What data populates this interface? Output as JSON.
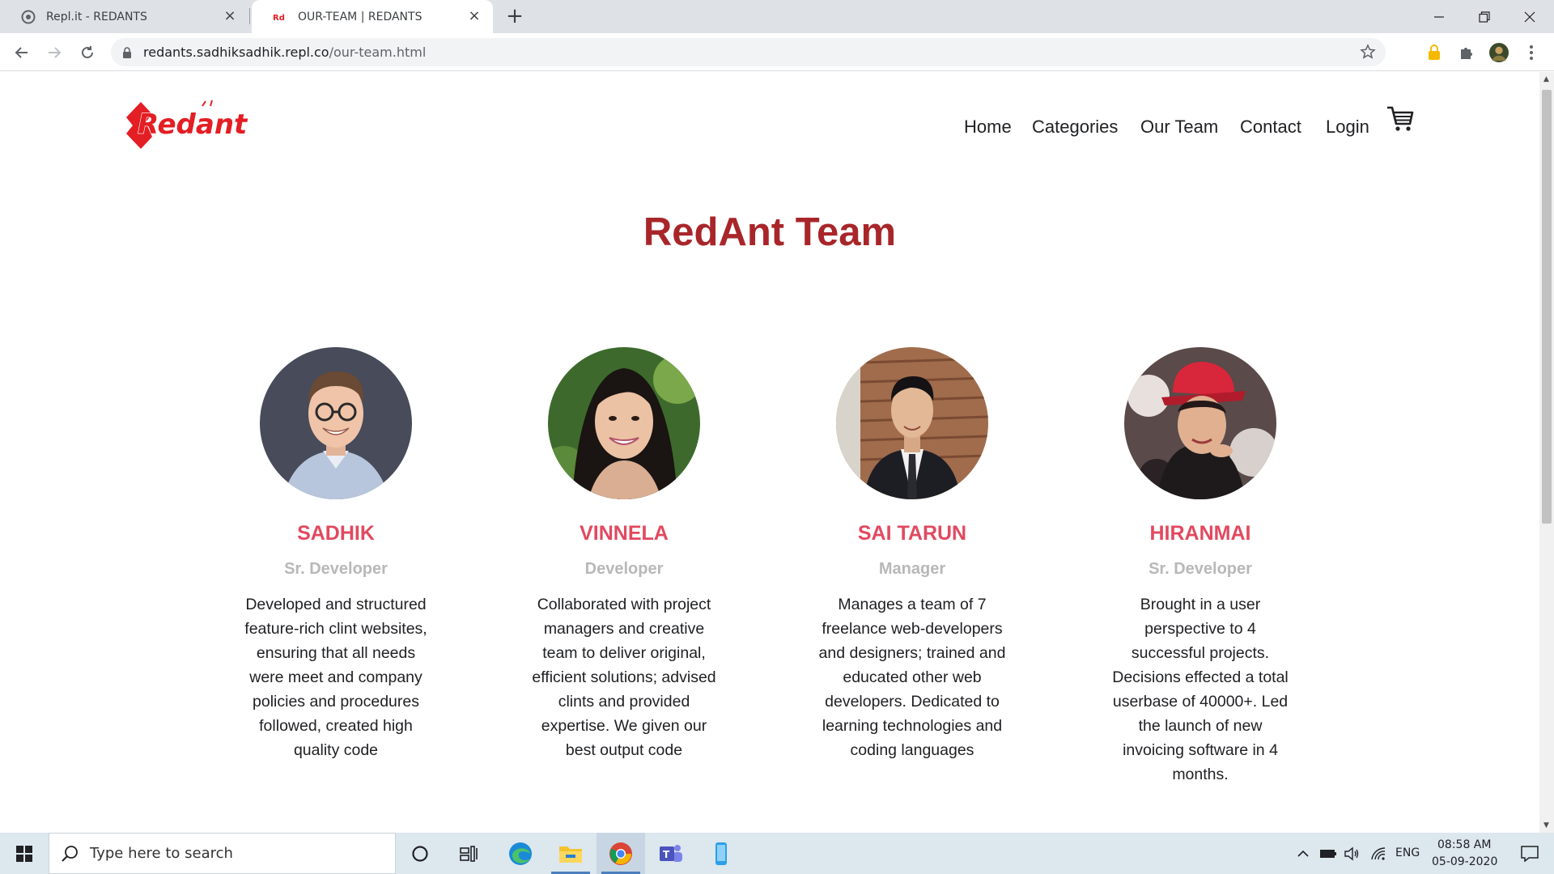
{
  "browser": {
    "tabs": [
      {
        "title": "Repl.it - REDANTS",
        "active": false
      },
      {
        "title": "OUR-TEAM | REDANTS",
        "active": true
      }
    ],
    "url_host": "redants.sadhiksadhik.repl.co",
    "url_path": "/our-team.html"
  },
  "nav": {
    "items": [
      "Home",
      "Categories",
      "Our Team",
      "Contact",
      "Login"
    ]
  },
  "logo_text": "Redant",
  "page": {
    "title": "RedAnt Team"
  },
  "team": [
    {
      "name": "SADHIK",
      "role": "Sr. Developer",
      "description": "Developed and structured feature-rich clint websites, ensuring that all needs were meet and company policies and procedures followed, created high quality code"
    },
    {
      "name": "VINNELA",
      "role": "Developer",
      "description": "Collaborated with project managers and creative team to deliver original, efficient solutions; advised clints and provided expertise. We given our best output code"
    },
    {
      "name": "SAI TARUN",
      "role": "Manager",
      "description": "Manages a team of 7 freelance web-developers and designers; trained and educated other web developers. Dedicated to learning technologies and coding languages"
    },
    {
      "name": "HIRANMAI",
      "role": "Sr. Developer",
      "description": "Brought in a user perspective to 4 successful projects. Decisions effected a total userbase of 40000+. Led the launch of new invoicing software in 4 months."
    }
  ],
  "taskbar": {
    "search_placeholder": "Type here to search",
    "language": "ENG",
    "time": "08:58 AM",
    "date": "05-09-2020"
  },
  "colors": {
    "title": "#a8262a",
    "member_name": "#e2495f",
    "member_role": "#b8b8b8",
    "brand_red": "#e31e24"
  }
}
